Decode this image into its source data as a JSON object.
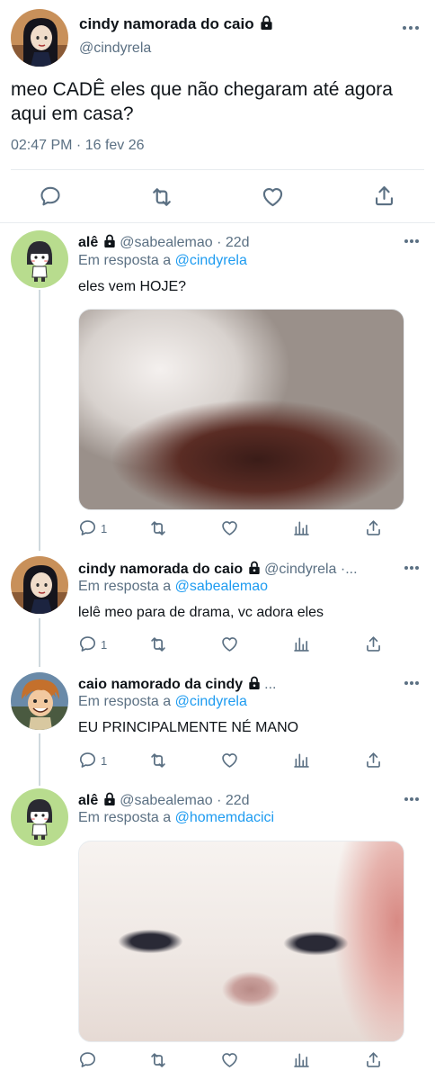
{
  "main_tweet": {
    "display_name": "cindy namorada do caio",
    "handle": "@cindyrela",
    "text": "meo CADÊ eles que não chegaram até agora aqui em casa?",
    "timestamp": "02:47 PM · 16 fev 26"
  },
  "replies": [
    {
      "display_name": "alê",
      "meta": "@sabealemao · 22d",
      "in_reply_prefix": "Em resposta a",
      "in_reply_mention": "@cindyrela",
      "text": "eles vem HOJE?",
      "reply_count": "1"
    },
    {
      "display_name": "cindy namorada do caio",
      "meta": "@cindyrela ·...",
      "in_reply_prefix": "Em resposta a",
      "in_reply_mention": "@sabealemao",
      "text": "lelê meo para de drama, vc adora eles",
      "reply_count": "1"
    },
    {
      "display_name": "caio namorado da cindy",
      "meta": "...",
      "in_reply_prefix": "Em resposta a",
      "in_reply_mention": "@cindyrela",
      "text": "EU PRINCIPALMENTE NÉ MANO",
      "reply_count": "1"
    },
    {
      "display_name": "alê",
      "meta": "@sabealemao · 22d",
      "in_reply_prefix": "Em resposta a",
      "in_reply_mention": "@homemdacici",
      "text": "",
      "reply_count": ""
    }
  ],
  "icons": {
    "reply": "reply-icon",
    "retweet": "retweet-icon",
    "like": "heart-icon",
    "views": "analytics-icon",
    "share": "share-icon",
    "more": "more-icon",
    "lock": "lock-icon"
  },
  "colors": {
    "text": "#0f1419",
    "secondary": "#5b7083",
    "link": "#1d9bf0",
    "divider": "#e8ecef",
    "thread_line": "#cfd9de"
  }
}
